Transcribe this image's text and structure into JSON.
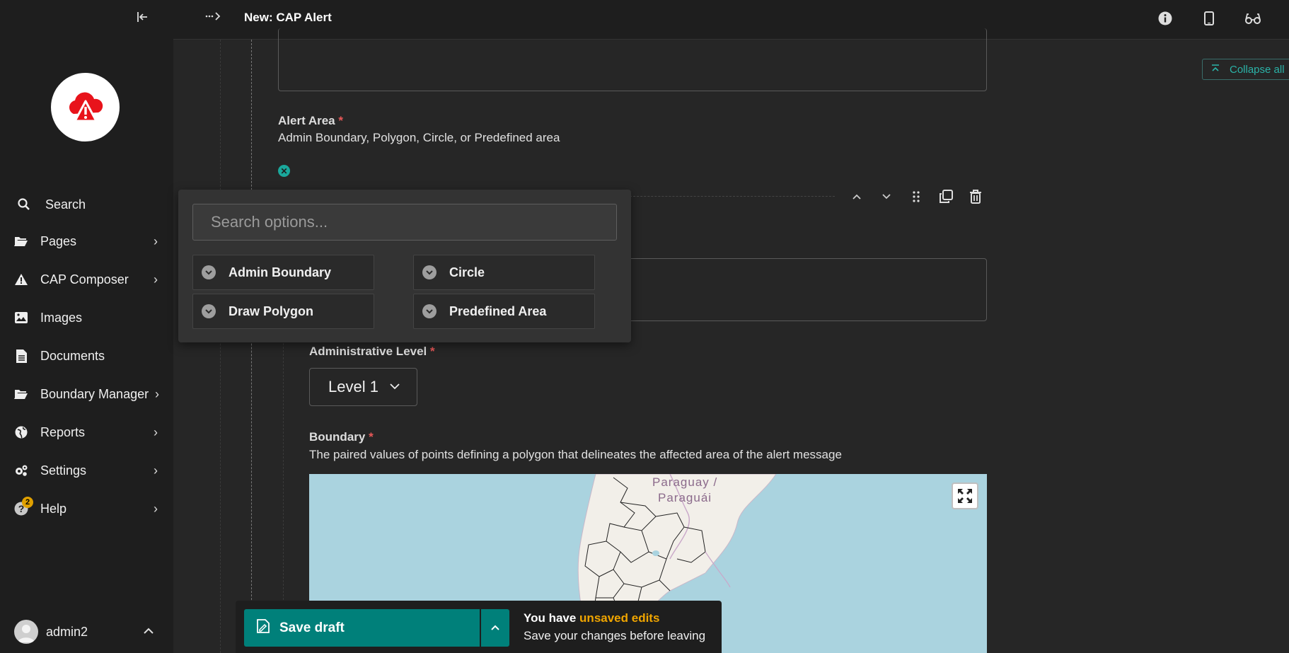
{
  "header": {
    "title": "New: CAP Alert"
  },
  "sidebar": {
    "items": [
      {
        "label": "Search",
        "icon": "search-icon"
      },
      {
        "label": "Pages",
        "icon": "folder-open-icon"
      },
      {
        "label": "CAP Composer",
        "icon": "warning-icon"
      },
      {
        "label": "Images",
        "icon": "image-icon"
      },
      {
        "label": "Documents",
        "icon": "document-icon"
      },
      {
        "label": "Boundary Manager",
        "icon": "folder-open-icon"
      },
      {
        "label": "Reports",
        "icon": "globe-icon"
      },
      {
        "label": "Settings",
        "icon": "cogs-icon"
      },
      {
        "label": "Help",
        "icon": "help-icon"
      }
    ],
    "help_badge": "2",
    "user": "admin2"
  },
  "content": {
    "collapse_all": "Collapse all",
    "alert_area_label": "Alert Area",
    "alert_area_help": "Admin Boundary, Polygon, Circle, or Predefined area",
    "admin_level_label": "Administrative Level",
    "admin_level_value": "Level 1",
    "boundary_label": "Boundary",
    "boundary_help": "The paired values of points defining a polygon that delineates the affected area of the alert message",
    "required_mark": "*"
  },
  "map": {
    "labels": [
      "Paraguay /",
      "Paraguái"
    ]
  },
  "popup": {
    "search_placeholder": "Search options...",
    "options": [
      "Admin Boundary",
      "Circle",
      "Draw Polygon",
      "Predefined Area"
    ]
  },
  "savebar": {
    "save_label": "Save draft",
    "msg_prefix": "You have ",
    "msg_highlight": "unsaved edits",
    "msg_sub": "Save your changes before leaving"
  },
  "colors": {
    "accent": "#00807a",
    "teal_text": "#2bb3a8",
    "warning": "#f0a500",
    "required": "#e85858",
    "logo_red": "#e8131b"
  }
}
